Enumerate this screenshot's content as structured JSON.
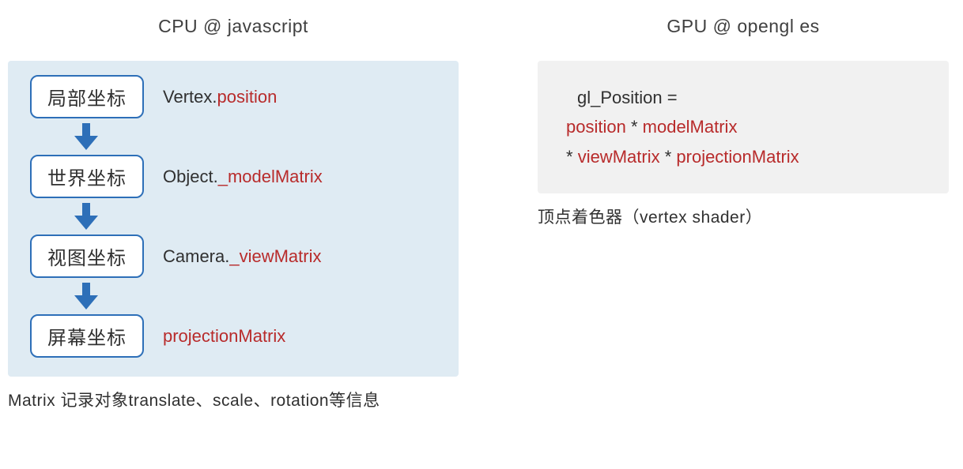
{
  "left": {
    "heading": "CPU @ javascript",
    "flow": [
      {
        "box": "局部坐标",
        "label_prefix": "Vertex.",
        "label_red": "position"
      },
      {
        "box": "世界坐标",
        "label_prefix": "Object.",
        "label_red": "_modelMatrix"
      },
      {
        "box": "视图坐标",
        "label_prefix": "Camera.",
        "label_red": "_viewMatrix"
      },
      {
        "box": "屏幕坐标",
        "label_prefix": "",
        "label_red": "projectionMatrix"
      }
    ],
    "caption": "Matrix 记录对象translate、scale、rotation等信息"
  },
  "right": {
    "heading": "GPU @ opengl es",
    "code": {
      "line1_pre": "gl_Position =",
      "line2_red1": "position",
      "line2_mid": " * ",
      "line2_red2": "modelMatrix",
      "line3_pre": "* ",
      "line3_red1": "viewMatrix",
      "line3_mid": " * ",
      "line3_red2": "projectionMatrix"
    },
    "caption": "顶点着色器（vertex shader）"
  },
  "colors": {
    "accent_blue": "#2d6fb8",
    "highlight_red": "#b82b2b",
    "panel_blue": "#dfebf3",
    "panel_gray": "#f1f1f1"
  }
}
